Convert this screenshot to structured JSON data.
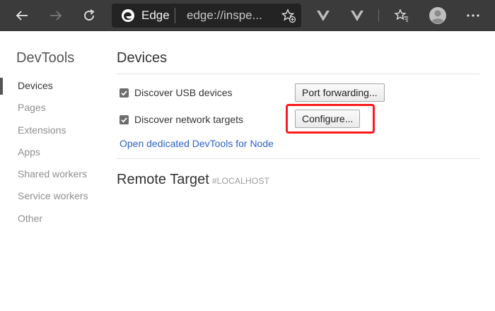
{
  "browser": {
    "site_name": "Edge",
    "url": "edge://inspe..."
  },
  "sidebar": {
    "title": "DevTools",
    "items": [
      {
        "label": "Devices",
        "selected": true
      },
      {
        "label": "Pages",
        "selected": false
      },
      {
        "label": "Extensions",
        "selected": false
      },
      {
        "label": "Apps",
        "selected": false
      },
      {
        "label": "Shared workers",
        "selected": false
      },
      {
        "label": "Service workers",
        "selected": false
      },
      {
        "label": "Other",
        "selected": false
      }
    ]
  },
  "main": {
    "title": "Devices",
    "discover_usb": {
      "label": "Discover USB devices",
      "checked": true
    },
    "discover_network": {
      "label": "Discover network targets",
      "checked": true
    },
    "port_forwarding_label": "Port forwarding...",
    "configure_label": "Configure...",
    "node_link": "Open dedicated DevTools for Node",
    "remote_target": {
      "title": "Remote Target",
      "host": "#LOCALHOST"
    }
  },
  "colors": {
    "toolbar_bg": "#3b3b3b",
    "address_bg": "#232323",
    "link": "#2b62c4",
    "highlight": "#ff1a1a"
  }
}
